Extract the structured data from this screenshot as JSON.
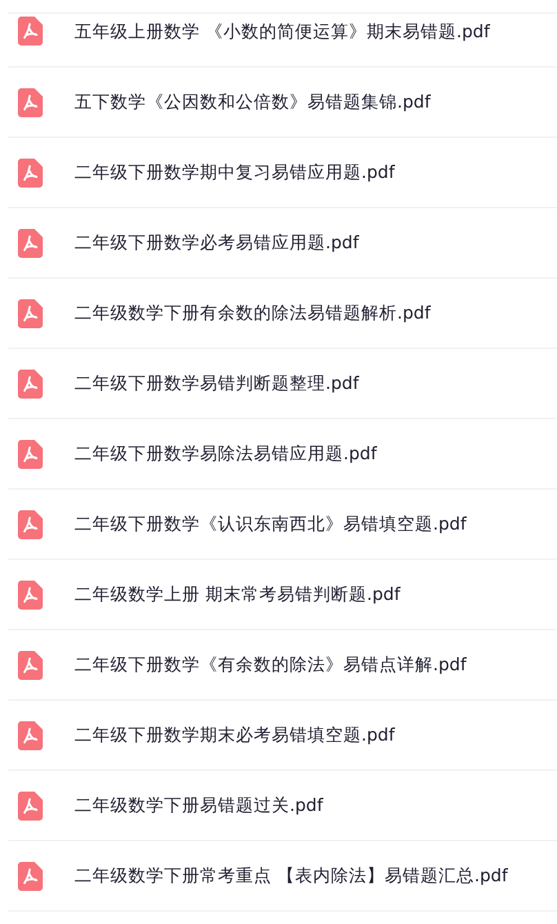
{
  "files": [
    {
      "name": "五年级上册数学 《小数的简便运算》期末易错题.pdf"
    },
    {
      "name": "五下数学《公因数和公倍数》易错题集锦.pdf"
    },
    {
      "name": "二年级下册数学期中复习易错应用题.pdf"
    },
    {
      "name": "二年级下册数学必考易错应用题.pdf"
    },
    {
      "name": "二年级数学下册有余数的除法易错题解析.pdf"
    },
    {
      "name": "二年级下册数学易错判断题整理.pdf"
    },
    {
      "name": "二年级下册数学易除法易错应用题.pdf"
    },
    {
      "name": "二年级下册数学《认识东南西北》易错填空题.pdf"
    },
    {
      "name": "二年级数学上册 期末常考易错判断题.pdf"
    },
    {
      "name": "二年级下册数学《有余数的除法》易错点详解.pdf"
    },
    {
      "name": "二年级下册数学期末必考易错填空题.pdf"
    },
    {
      "name": "二年级数学下册易错题过关.pdf"
    },
    {
      "name": "二年级数学下册常考重点 【表内除法】易错题汇总.pdf"
    }
  ]
}
